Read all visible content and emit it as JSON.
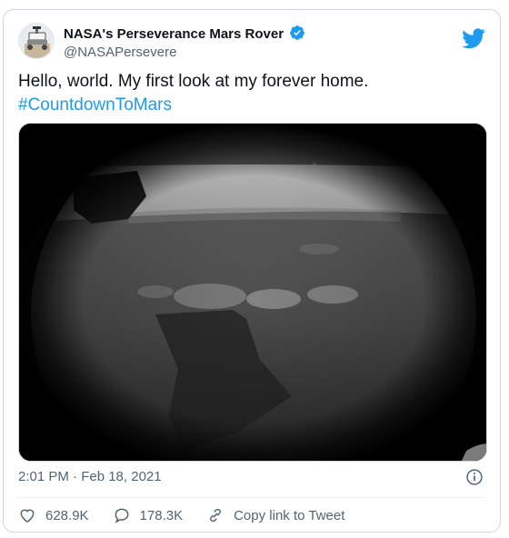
{
  "tweet": {
    "display_name": "NASA's Perseverance Mars Rover",
    "handle": "@NASAPersevere",
    "text": "Hello, world. My first look at my forever home.",
    "hashtag": "#CountdownToMars",
    "timestamp": "2:01 PM · Feb 18, 2021"
  },
  "actions": {
    "likes": "628.9K",
    "replies": "178.3K",
    "copy_link_label": "Copy link to Tweet"
  },
  "colors": {
    "accent": "#1d9bf0",
    "secondary_text": "#536471",
    "border": "#cfd9de"
  },
  "icons": {
    "brand": "twitter-bird-icon",
    "verified": "verified-badge-icon",
    "info": "info-icon",
    "like": "heart-icon",
    "reply": "reply-bubble-icon",
    "copy_link": "link-icon"
  }
}
